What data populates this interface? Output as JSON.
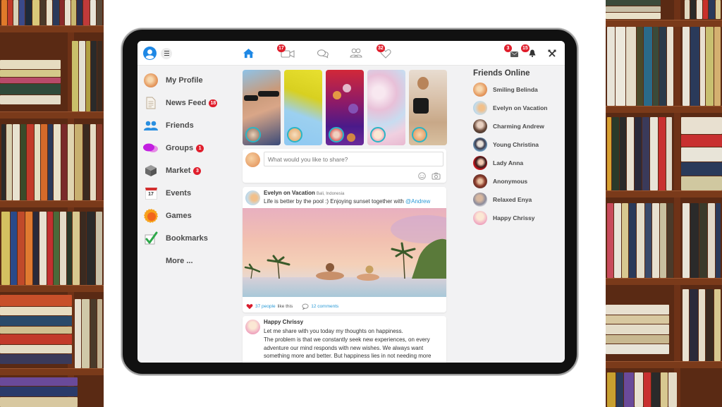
{
  "topbar": {
    "icons": {
      "profile": "user-circle-icon",
      "menu": "hamburger-menu-icon",
      "home": "home-icon",
      "video": "video-camera-icon",
      "chat": "chat-bubbles-icon",
      "friends": "friends-icon",
      "likes": "heart-icon",
      "messages": "envelope-icon",
      "notifications": "bell-icon",
      "settings": "tools-icon"
    },
    "badges": {
      "video": "17",
      "likes": "32",
      "messages": "3",
      "notifications": "15"
    },
    "accent_color": "#2a9ad6",
    "badge_color": "#e01e2c"
  },
  "sidebar": {
    "items": [
      {
        "label": "My Profile",
        "icon": "profile-avatar-icon",
        "badge": null
      },
      {
        "label": "News Feed",
        "icon": "document-icon",
        "badge": "18"
      },
      {
        "label": "Friends",
        "icon": "friends-icon",
        "badge": null
      },
      {
        "label": "Groups",
        "icon": "speech-bubbles-icon",
        "badge": "1"
      },
      {
        "label": "Market",
        "icon": "box-icon",
        "badge": "3"
      },
      {
        "label": "Events",
        "icon": "calendar-icon",
        "badge": null,
        "icon_text": "17"
      },
      {
        "label": "Games",
        "icon": "games-icon",
        "badge": null
      },
      {
        "label": "Bookmarks",
        "icon": "checkmark-icon",
        "badge": null
      },
      {
        "label": "More ...",
        "icon": null,
        "badge": null
      }
    ]
  },
  "stories": [
    {
      "name": "story-selfie-couple"
    },
    {
      "name": "story-palm-leaf"
    },
    {
      "name": "story-bokeh-lights"
    },
    {
      "name": "story-cherry-blossom"
    },
    {
      "name": "story-beach-runner"
    }
  ],
  "composer": {
    "placeholder": "What would you like to share?",
    "icons": [
      "smiley-icon",
      "camera-icon"
    ]
  },
  "posts": [
    {
      "author": "Evelyn on Vacation",
      "location": "Bali, Indonesia",
      "text": "Life is better by the pool :) Enjoying sunset together with ",
      "mention": "@Andrew",
      "likes_label": "37 people",
      "likes_suffix": "like this",
      "comments_label": "12 comments"
    },
    {
      "author": "Happy Chrissy",
      "paragraphs": [
        "Let me share with you today my thoughts on happiness.",
        "The problem is that we constantly seek new experiences, on every adventure our mind responds with new wishes. We always want something more and better. But happiness lies in not needing more"
      ]
    }
  ],
  "friends_online": {
    "title": "Friends Online",
    "friends": [
      {
        "name": "Smiling Belinda"
      },
      {
        "name": "Evelyn on Vacation"
      },
      {
        "name": "Charming Andrew"
      },
      {
        "name": "Young Christina"
      },
      {
        "name": "Lady Anna"
      },
      {
        "name": "Anonymous"
      },
      {
        "name": "Relaxed Enya"
      },
      {
        "name": "Happy Chrissy"
      }
    ]
  }
}
